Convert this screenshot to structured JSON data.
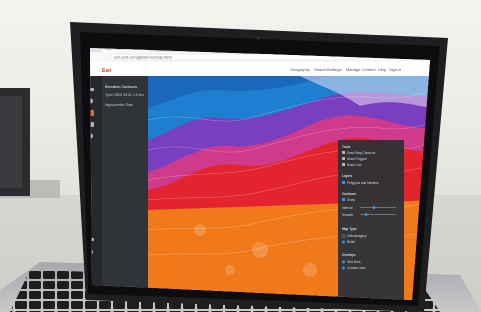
{
  "browser": {
    "tab_title": "Esri ArcGIS",
    "address": "esri.esri.com/gis/demo/map.html",
    "logo_text": "Esri",
    "top_links": [
      "Geography",
      "Search",
      "Settings",
      "Manage Content",
      "Help",
      "Sign in"
    ]
  },
  "sidebar": {
    "title": "Elevation Contours",
    "subtitle": "Tyrol, DEM 2013, 2.5 km",
    "item": "Hypsometric Tints"
  },
  "tools_panel": {
    "header": "Tools",
    "tools": [
      "Draw Map Contours",
      "Draw Polygon",
      "Draw Line"
    ],
    "layers_header": "Layers",
    "layer": "Polygons and Markers",
    "contours_header": "Contours",
    "contour_option": "Show",
    "sliders": [
      "Interval",
      "Smooth"
    ],
    "maptype_header": "Map Type",
    "map_types": [
      "Orthoimagery",
      "Relief"
    ],
    "overlays_header": "Overlays",
    "overlays": [
      "Grid lines",
      "Contour lines"
    ]
  },
  "colors": {
    "band_blue": "#1e7fd0",
    "band_violet": "#7a3fc0",
    "band_pink": "#d03a8a",
    "band_red": "#e3242e",
    "band_orange": "#f07a1a",
    "panel_bg": "#2f3236",
    "sidebar_bg": "#303338"
  }
}
